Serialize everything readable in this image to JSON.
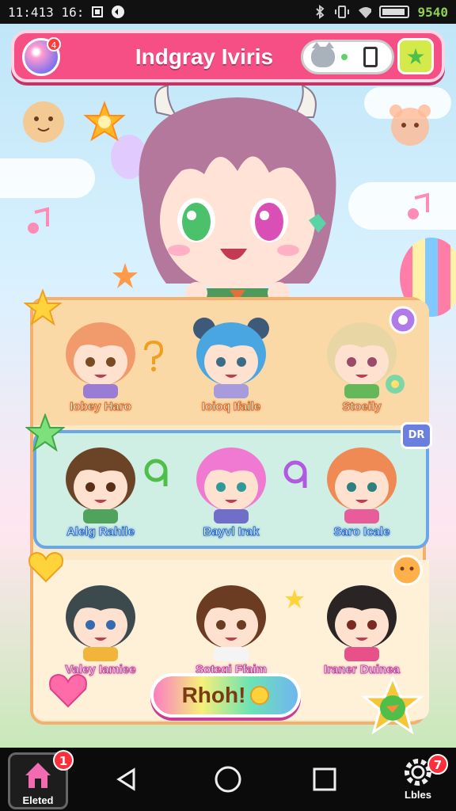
{
  "status_bar": {
    "time": "11:413 16:",
    "battery": "9540"
  },
  "header": {
    "title": "Indgray Iviris",
    "orb_badge": "4"
  },
  "characters": [
    {
      "name": "Iobey Haro"
    },
    {
      "name": "Ioioq Ifaile"
    },
    {
      "name": "Stoeily"
    },
    {
      "name": "Alelg Rahile"
    },
    {
      "name": "Bayvl Irak"
    },
    {
      "name": "Saro Icale"
    },
    {
      "name": "Valey Iamiee"
    },
    {
      "name": "Sotegi Ffaim"
    },
    {
      "name": "Iraner Duinea"
    }
  ],
  "row_badge": "DR",
  "play_button": {
    "label": "Rhoh!"
  },
  "nav": {
    "home_label": "Eleted",
    "home_badge": "1",
    "settings_label": "Lbles",
    "settings_badge": "7"
  },
  "colors": {
    "header": "#f54f86",
    "panel": "#fde8c6",
    "selected_row_border": "#6aa7e8"
  }
}
